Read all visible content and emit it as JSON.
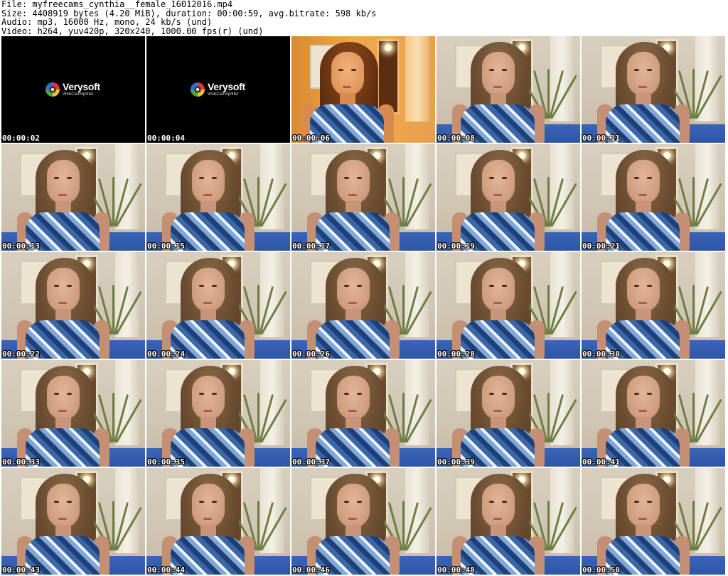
{
  "header": {
    "file_line": "File: myfreecams_cynthia__female_16012016.mp4",
    "size_line": "Size: 4408919 bytes (4.20 MiB), duration: 00:00:59, avg.bitrate: 598 kb/s",
    "audio_line": "Audio: mp3, 16000 Hz, mono, 24 kb/s (und)",
    "video_line": "Video: h264, yuv420p, 320x240, 1000.00 fps(r) (und)"
  },
  "logo": {
    "name": "Verysoft",
    "subtitle": "WebCamSplitter"
  },
  "thumbnails": [
    {
      "time": "00:00:02",
      "scene": "logo"
    },
    {
      "time": "00:00:04",
      "scene": "logo"
    },
    {
      "time": "00:00:06",
      "scene": "warm"
    },
    {
      "time": "00:00:08",
      "scene": "room"
    },
    {
      "time": "00:00:11",
      "scene": "room"
    },
    {
      "time": "00:00:13",
      "scene": "room"
    },
    {
      "time": "00:00:15",
      "scene": "room"
    },
    {
      "time": "00:00:17",
      "scene": "room"
    },
    {
      "time": "00:00:19",
      "scene": "room"
    },
    {
      "time": "00:00:21",
      "scene": "room"
    },
    {
      "time": "00:00:22",
      "scene": "room"
    },
    {
      "time": "00:00:24",
      "scene": "room"
    },
    {
      "time": "00:00:26",
      "scene": "room"
    },
    {
      "time": "00:00:28",
      "scene": "room"
    },
    {
      "time": "00:00:30",
      "scene": "room"
    },
    {
      "time": "00:00:33",
      "scene": "room"
    },
    {
      "time": "00:00:35",
      "scene": "room"
    },
    {
      "time": "00:00:37",
      "scene": "room"
    },
    {
      "time": "00:00:39",
      "scene": "room"
    },
    {
      "time": "00:00:41",
      "scene": "room"
    },
    {
      "time": "00:00:43",
      "scene": "room"
    },
    {
      "time": "00:00:44",
      "scene": "room"
    },
    {
      "time": "00:00:46",
      "scene": "room"
    },
    {
      "time": "00:00:48",
      "scene": "room"
    },
    {
      "time": "00:00:50",
      "scene": "room"
    }
  ]
}
